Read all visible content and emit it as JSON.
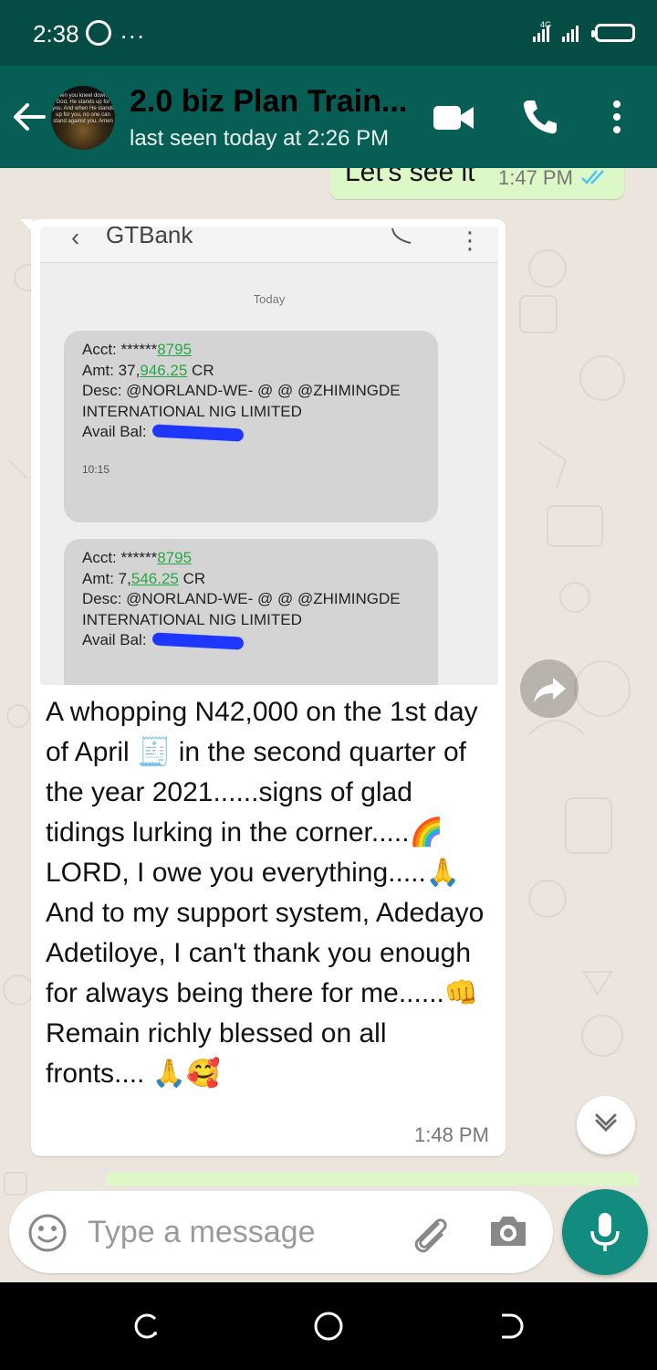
{
  "status_bar": {
    "time": "2:38",
    "more": "...",
    "network": "4G"
  },
  "header": {
    "title": "2.0 biz Plan Train...",
    "subtitle": "last seen today at 2:26 PM",
    "avatar_text": "When you kneel down to God, He stands up for you. And when He stands up for you, no one can stand against you. Amen"
  },
  "messages": {
    "outgoing": {
      "text": "Let's see it",
      "time": "1:47 PM"
    },
    "incoming": {
      "screenshot": {
        "title": "GTBank",
        "date_label": "Today",
        "sms": [
          {
            "acct_prefix": "Acct: ******",
            "acct_num": "8795",
            "amt_prefix": "Amt: 37,",
            "amt_num": "946.25",
            "amt_suffix": " CR",
            "desc": "Desc:  @NORLAND-WE- @ @ @ZHIMINGDE INTERNATIONAL NIG LIMITED",
            "bal_label": "Avail Bal:",
            "time": "10:15"
          },
          {
            "acct_prefix": "Acct: ******",
            "acct_num": "8795",
            "amt_prefix": "Amt: 7,",
            "amt_num": "546.25",
            "amt_suffix": " CR",
            "desc": "Desc:  @NORLAND-WE- @ @ @ZHIMINGDE INTERNATIONAL NIG LIMITED",
            "bal_label": "Avail Bal:"
          }
        ]
      },
      "caption": {
        "p1": "A whopping N42,000 on the 1st day of April ",
        "e1": "🧾",
        "p2": " in the second quarter of the year 2021......signs of glad tidings lurking in the corner.....",
        "e2": "🌈",
        "p3": " LORD, I owe you everything.....",
        "e3": "🙏",
        "p4": "  And to my support system, Adedayo Adetiloye, I can't thank you enough for always being there for me......",
        "e4": "👊",
        "p5": "Remain richly blessed on all fronts....",
        "e5": "🙏🥰"
      },
      "time": "1:48 PM"
    }
  },
  "input": {
    "placeholder": "Type a message",
    "value": ""
  },
  "colors": {
    "header": "#075e54",
    "status_bar": "#054d44",
    "outgoing_bubble": "#dcf8c6",
    "incoming_bubble": "#ffffff",
    "read_ticks": "#4fc3f7",
    "mic_button": "#128c7e"
  },
  "icons": [
    "whatsapp-icon",
    "signal-icon",
    "battery-icon",
    "back-arrow-icon",
    "video-call-icon",
    "voice-call-icon",
    "kebab-menu-icon",
    "read-ticks-icon",
    "forward-icon",
    "chevron-down-icon",
    "emoji-icon",
    "attach-icon",
    "camera-icon",
    "mic-icon",
    "recent-apps-icon",
    "home-icon",
    "back-nav-icon"
  ]
}
